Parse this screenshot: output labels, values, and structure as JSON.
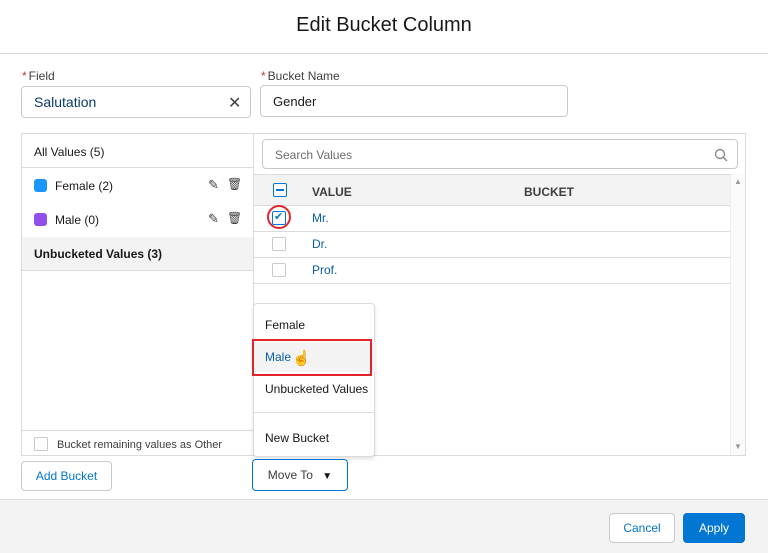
{
  "dialog": {
    "title": "Edit Bucket Column"
  },
  "field": {
    "label": "Field",
    "required_mark": "*",
    "value": "Salutation",
    "clear_icon": "close-icon"
  },
  "bucket_name": {
    "label": "Bucket Name",
    "required_mark": "*",
    "value": "Gender"
  },
  "left_panel": {
    "all_values": "All Values (5)",
    "items": [
      {
        "label": "Female (2)",
        "icon": "tag-icon",
        "icon_color": "#1b96ff"
      },
      {
        "label": "Male (0)",
        "icon": "tag-icon",
        "icon_color": "#9050e9"
      }
    ],
    "unbucketed": "Unbucketed Values (3)",
    "remaining_checkbox_label": "Bucket remaining values as Other"
  },
  "search": {
    "placeholder": "Search Values"
  },
  "table": {
    "headers": [
      "VALUE",
      "BUCKET"
    ],
    "rows": [
      {
        "value": "Mr.",
        "checked": true
      },
      {
        "value": "Dr.",
        "checked": false
      },
      {
        "value": "Prof.",
        "checked": false
      }
    ]
  },
  "move_menu": {
    "items": [
      "Female",
      "Male",
      "Unbucketed Values"
    ],
    "new_bucket": "New Bucket",
    "highlighted": "Male"
  },
  "footer": {
    "add_bucket": "Add Bucket",
    "move_to": "Move To",
    "cancel": "Cancel",
    "apply": "Apply"
  },
  "colors": {
    "brand": "#0176d3",
    "link": "#0b5cab",
    "highlight_box": "#e3242b"
  }
}
